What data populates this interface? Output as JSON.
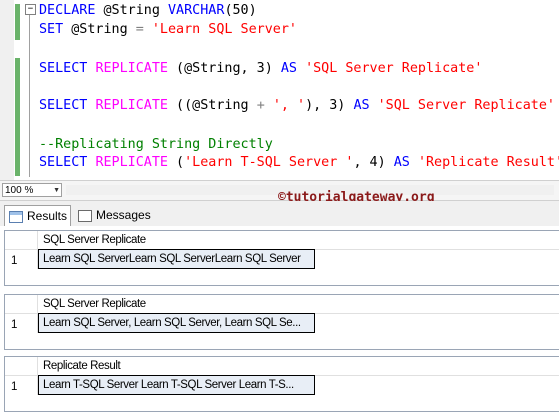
{
  "editor": {
    "collapse_symbol": "−",
    "line1": {
      "kw1": "DECLARE",
      "var": " @String ",
      "kw2": "VARCHAR",
      "rest": "(50)"
    },
    "line2": {
      "kw": "SET",
      "var": " @String ",
      "op": "=",
      "sp": " ",
      "str": "'Learn SQL Server'"
    },
    "line3": {
      "kw": "SELECT",
      "sp": " ",
      "fn": "REPLICATE",
      "a": " (@String, 3) ",
      "kw2": "AS",
      "sp2": " ",
      "str": "'SQL Server Replicate'"
    },
    "line4": {
      "kw": "SELECT",
      "sp": " ",
      "fn": "REPLICATE",
      "a": " ((@String ",
      "op": "+",
      "sp3": " ",
      "str1": "', '",
      "b": "), 3) ",
      "kw2": "AS",
      "sp2": " ",
      "str2": "'SQL Server Replicate'"
    },
    "line5": {
      "comment": "--Replicating String Directly"
    },
    "line6": {
      "kw": "SELECT",
      "sp": " ",
      "fn": "REPLICATE",
      "a": " (",
      "str1": "'Learn T-SQL Server '",
      "b": ", 4) ",
      "kw2": "AS",
      "sp2": " ",
      "str2": "'Replicate Result'"
    }
  },
  "statusbar": {
    "zoom": "100 %"
  },
  "watermark": "©tutorialgateway.org",
  "tabs": {
    "results": "Results",
    "messages": "Messages"
  },
  "results": [
    {
      "column": "SQL Server Replicate",
      "row_number": "1",
      "value": "Learn SQL ServerLearn SQL ServerLearn SQL Server"
    },
    {
      "column": "SQL Server Replicate",
      "row_number": "1",
      "value": "Learn SQL Server, Learn SQL Server, Learn SQL Se..."
    },
    {
      "column": "Replicate Result",
      "row_number": "1",
      "value": "Learn T-SQL Server Learn T-SQL Server Learn T-S..."
    }
  ],
  "colors": {
    "keyword": "#0000ff",
    "function": "#ff00ff",
    "string": "#ff0000",
    "comment": "#008000",
    "watermark": "#8b1a1a"
  }
}
